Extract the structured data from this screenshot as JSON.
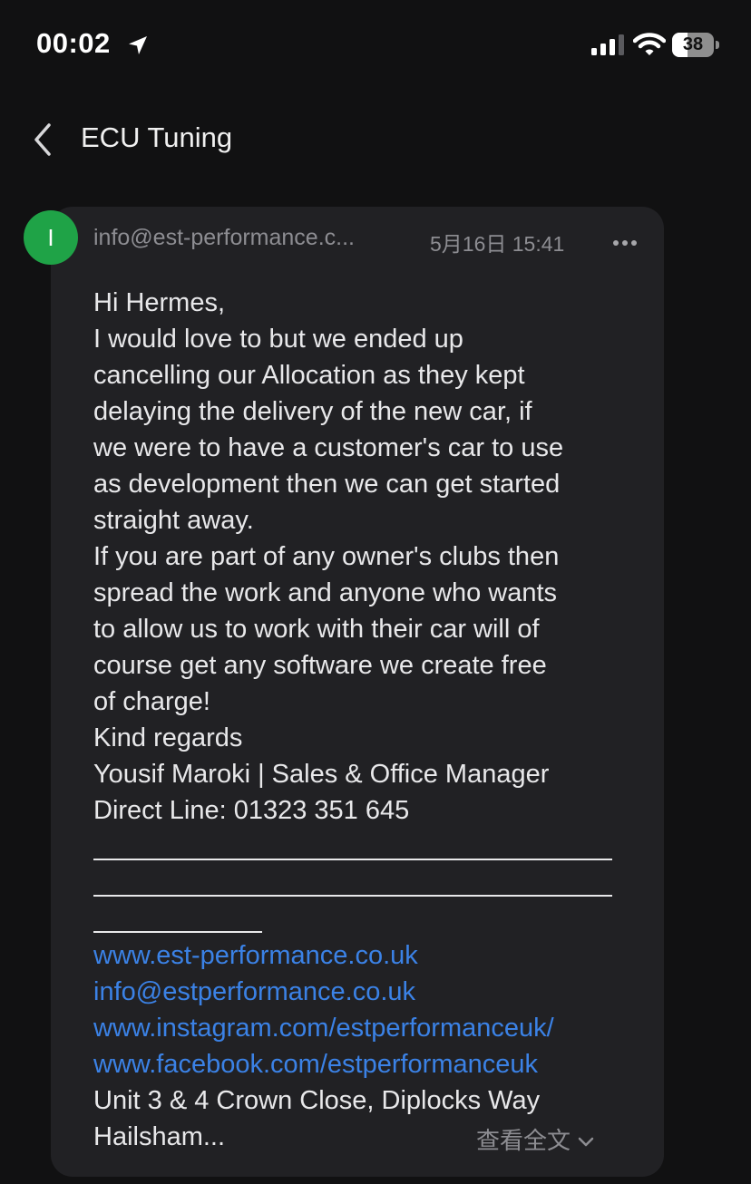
{
  "status_bar": {
    "time": "00:02",
    "battery_level": "38",
    "battery_fraction": 0.38,
    "icons": [
      "location-arrow-icon",
      "cellular-signal-icon",
      "wifi-icon",
      "battery-icon"
    ]
  },
  "nav": {
    "title": "ECU Tuning",
    "back_icon": "chevron-left-icon"
  },
  "message": {
    "avatar_letter": "I",
    "avatar_color": "#1fa347",
    "sender": "info@est-performance.c...",
    "date": "5月16日 15:41",
    "more_icon": "ellipsis-icon",
    "lines": [
      "Hi Hermes,",
      "I would love to but we ended up",
      "cancelling our Allocation as they kept",
      "delaying the delivery of the new car, if",
      "we were to have a customer's car to use",
      "as development then we can get started",
      "straight away.",
      "If you are part of any owner's clubs then",
      "spread the work and anyone who wants",
      "to allow us to work with their car will of",
      "course get any software we create free",
      "of charge!",
      "Kind regards",
      "Yousif Maroki | Sales & Office Manager",
      "Direct Line: 01323 351 645"
    ],
    "links": [
      "www.est-performance.co.uk",
      "info@estperformance.co.uk",
      "www.instagram.com/estperformanceuk/",
      "www.facebook.com/estperformanceuk"
    ],
    "address_lines": [
      "Unit 3 & 4 Crown Close, Diplocks Way",
      "Hailsham..."
    ],
    "view_all_label": "查看全文"
  },
  "colors": {
    "background": "#111112",
    "card": "#212124",
    "link": "#3b82e6",
    "secondary_text": "#8d8d92"
  }
}
